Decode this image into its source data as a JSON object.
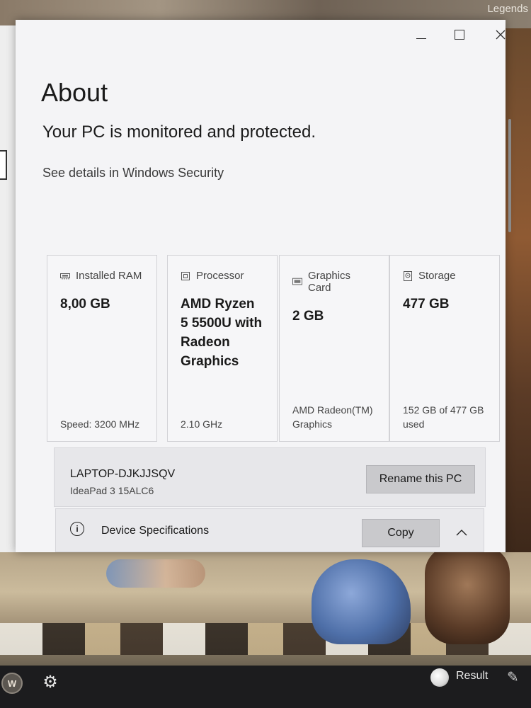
{
  "desktop": {
    "corner_text": "Legends"
  },
  "window": {
    "title": "About",
    "protection_status": "Your PC is monitored and protected.",
    "security_link": "See details in Windows Security",
    "specs": [
      {
        "label": "Installed RAM",
        "icon": "ram-icon",
        "value": "8,00 GB",
        "footer": "Speed: 3200 MHz"
      },
      {
        "label": "Processor",
        "icon": "processor-icon",
        "value": "AMD Ryzen 5 5500U with Radeon Graphics",
        "footer": "2.10 GHz"
      },
      {
        "label": "Graphics Card",
        "icon": "graphics-card-icon",
        "value": "2 GB",
        "footer": "AMD Radeon(TM) Graphics"
      },
      {
        "label": "Storage",
        "icon": "storage-icon",
        "value": "477 GB",
        "footer": "152 GB of 477 GB used"
      }
    ],
    "device": {
      "name": "LAPTOP-DJKJJSQV",
      "model": "IdeaPad 3 15ALC6",
      "rename_label": "Rename this PC"
    },
    "device_specs": {
      "label": "Device Specifications",
      "copy_label": "Copy"
    }
  },
  "taskbar": {
    "app_letter": "W",
    "result_label": "Result"
  }
}
